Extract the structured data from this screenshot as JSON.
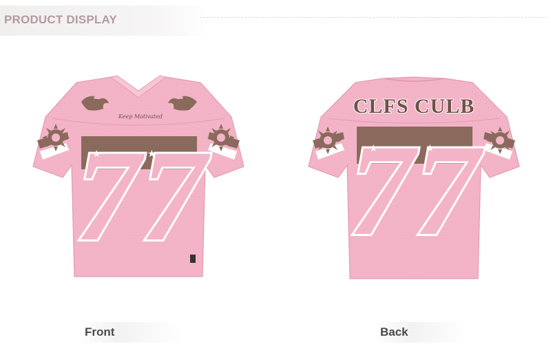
{
  "header": {
    "title": "PRODUCT DISPLAY"
  },
  "products": {
    "front": {
      "caption": "Front",
      "chest_text": "Keep Motivated",
      "number": "77"
    },
    "back": {
      "caption": "Back",
      "name_text": "CLFS CULB",
      "number": "77"
    }
  },
  "colors": {
    "shirt_pink": "#f4b4c8",
    "graphic_brown": "#8a6a5c",
    "accent_white": "#ffffff",
    "caption_text": "#4a4a4a",
    "header_text": "#b39aa1"
  }
}
